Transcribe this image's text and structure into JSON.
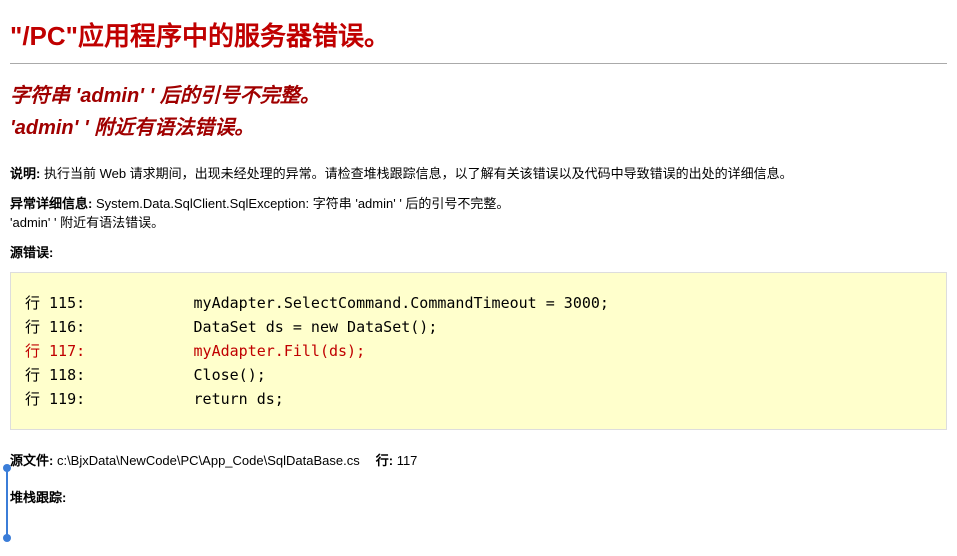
{
  "title": "\"/PC\"应用程序中的服务器错误。",
  "subtitle": "字符串 'admin' ' 后的引号不完整。\n'admin' ' 附近有语法错误。",
  "description": {
    "label": "说明:",
    "text": " 执行当前 Web 请求期间，出现未经处理的异常。请检查堆栈跟踪信息，以了解有关该错误以及代码中导致错误的出处的详细信息。"
  },
  "exception": {
    "label": "异常详细信息:",
    "text": " System.Data.SqlClient.SqlException: 字符串 'admin' ' 后的引号不完整。\n'admin' ' 附近有语法错误。"
  },
  "sourceError": {
    "label": "源错误:"
  },
  "code": {
    "line115": "行 115:            myAdapter.SelectCommand.CommandTimeout = 3000;",
    "line116": "行 116:            DataSet ds = new DataSet();",
    "line117": "行 117:            myAdapter.Fill(ds);",
    "line118": "行 118:            Close();",
    "line119": "行 119:            return ds;"
  },
  "sourceFile": {
    "label": "源文件:",
    "path": " c:\\BjxData\\NewCode\\PC\\App_Code\\SqlDataBase.cs",
    "lineLabel": "行:",
    "lineNum": " 117"
  },
  "stack": {
    "label": "堆栈跟踪:"
  }
}
